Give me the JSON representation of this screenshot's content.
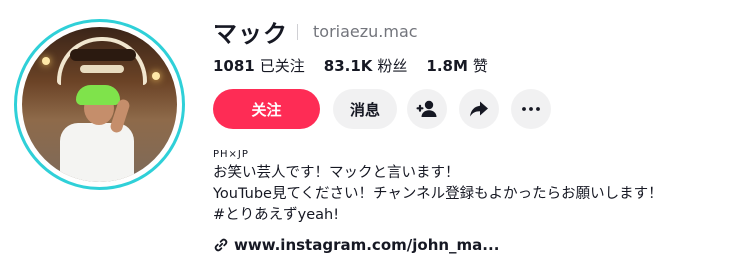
{
  "profile": {
    "name": "マック",
    "handle": "toriaezu.mac"
  },
  "stats": [
    {
      "value": "1081",
      "label": "已关注"
    },
    {
      "value": "83.1K",
      "label": "粉丝"
    },
    {
      "value": "1.8M",
      "label": "赞"
    }
  ],
  "actions": {
    "follow_label": "关注",
    "message_label": "消息"
  },
  "icons": {
    "add_friend": "add-friend-icon",
    "share": "share-icon",
    "more": "more-icon",
    "link": "link-icon"
  },
  "colors": {
    "accent": "#fe2c55",
    "ring": "#2fd0d8",
    "button_bg": "#f1f1f2"
  },
  "bio": {
    "region": "PH×JP",
    "lines": [
      "お笑い芸人です！マックと言います！",
      "YouTube見てください！チャンネル登録もよかったらお願いします！",
      "#とりあえずyeah!"
    ],
    "link": "www.instagram.com/john_ma..."
  }
}
